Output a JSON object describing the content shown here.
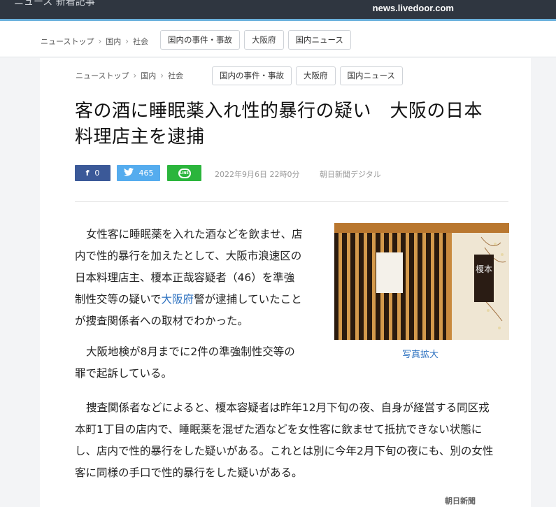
{
  "header": {
    "domain": "news.livedoor.com",
    "top_left_partial": "ニュース  新着記事"
  },
  "nav": {
    "breadcrumbs": [
      "ニューストップ",
      "国内",
      "社会"
    ],
    "tags": [
      "国内の事件・事故",
      "大阪府",
      "国内ニュース"
    ]
  },
  "article": {
    "breadcrumbs": [
      "ニューストップ",
      "国内",
      "社会"
    ],
    "tags": [
      "国内の事件・事故",
      "大阪府",
      "国内ニュース"
    ],
    "title_line1": "客の酒に睡眠薬入れ性的暴行の疑い　大阪の日本",
    "title_line2": "料理店主を逮捕",
    "share": {
      "facebook_count": "0",
      "twitter_count": "465",
      "line_label": "LINE"
    },
    "date": "2022年9月6日 22時0分",
    "source": "朝日新聞デジタル",
    "p1_l1": "女性客に睡眠薬を入れた酒などを飲ませ、店",
    "p1_l2": "内で性的暴行を加えたとして、大阪市浪速区の",
    "p1_l3": "日本料理店主、榎本正哉容疑者（46）を準強",
    "p1_l4_a": "制性交等の疑いで",
    "p1_l4_link": "大阪府",
    "p1_l4_b": "警が逮捕していたこと",
    "p1_l5": "が捜査関係者への取材でわかった。",
    "p2_l1": "大阪地検が8月までに2件の準強制性交等の",
    "p2_l2": "罪で起訴している。",
    "p3_l1": "捜査関係者などによると、榎本容疑者は昨年12月下旬の夜、自身が経営する同区戎",
    "p3_l2": "本町1丁目の店内で、睡眠薬を混ぜた酒などを女性客に飲ませて抵抗できない状態に",
    "p3_l3": "し、店内で性的暴行をした疑いがある。これとは別に今年2月下旬の夜にも、別の女性",
    "p3_l4": "客に同様の手口で性的暴行をした疑いがある。",
    "photo_link": "写真拡大",
    "photo_sign_text": "榎本",
    "footer_logo": "朝日新聞"
  },
  "colors": {
    "topbar": "#2f3640",
    "accent": "#6cb2dd",
    "facebook": "#3b5998",
    "twitter": "#55acee",
    "line": "#2bb53c",
    "link": "#2a6fbf"
  }
}
